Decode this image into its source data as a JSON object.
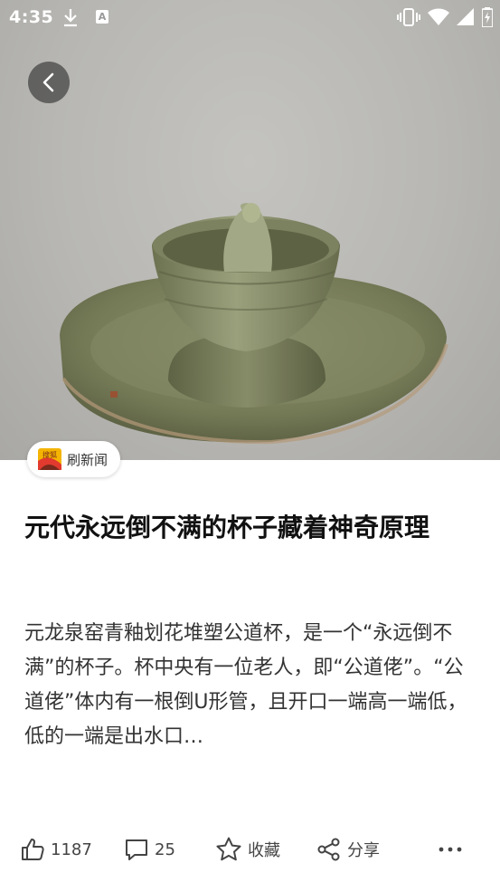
{
  "status_bar": {
    "time": "4:35",
    "a_badge": "A"
  },
  "source": {
    "name": "刷新闻",
    "logo_text": "搜狐"
  },
  "article": {
    "title": "元代永远倒不满的杯子藏着神奇原理",
    "summary": "元龙泉窑青釉划花堆塑公道杯，是一个“永远倒不满”的杯子。杯中央有一位老人，即“公道佬”。“公道佬”体内有一根倒U形管，且开口一端高一端低，低的一端是出水口…"
  },
  "actions": {
    "like_count": "1187",
    "comment_count": "25",
    "favorite_label": "收藏",
    "share_label": "分享"
  },
  "icons": [
    "back-arrow-icon",
    "download-icon",
    "vibrate-icon",
    "wifi-icon",
    "signal-icon",
    "battery-icon",
    "thumbs-up-icon",
    "comment-icon",
    "star-icon",
    "share-icon",
    "more-icon"
  ],
  "colors": {
    "hero_bg": "#b8b7b3",
    "celadon": "#7f8560",
    "text_dark": "#111111",
    "text_body": "#333333"
  }
}
